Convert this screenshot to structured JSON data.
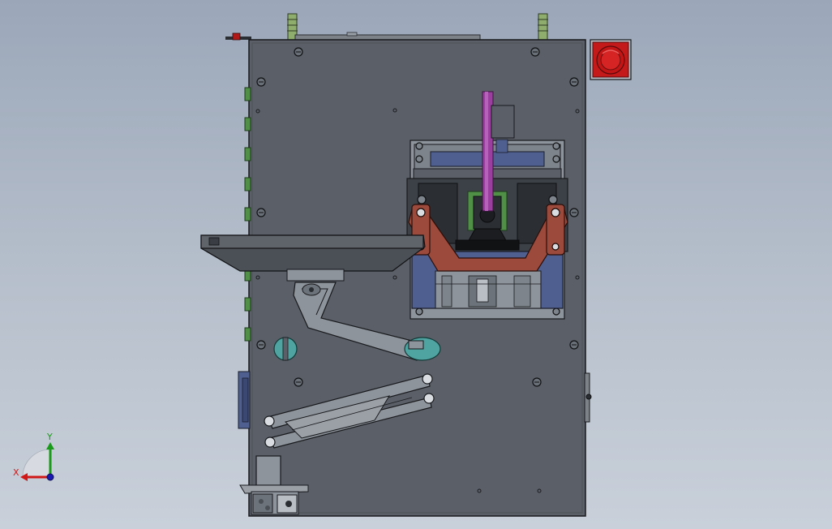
{
  "triad": {
    "x_label": "X",
    "y_label": "Y",
    "x_color": "#d01818",
    "y_color": "#1a9a1a",
    "z_color": "#1a1ab0"
  },
  "colors": {
    "background_top": "#9ba7b9",
    "background_bottom": "#c9d0da",
    "frame_panel": "#5b6068",
    "edge": "#17191c",
    "estop_red": "#c41a1a",
    "rod_magenta": "#9a3f9e",
    "link_brown": "#9b4a3c",
    "carriage_blue": "#4f5f90",
    "teal_knob": "#4fa3a0",
    "standoff_green": "#8fae6e",
    "connector_green": "#4f8f46"
  },
  "icons": [
    "emergency-stop-icon",
    "coordinate-triad-icon"
  ]
}
